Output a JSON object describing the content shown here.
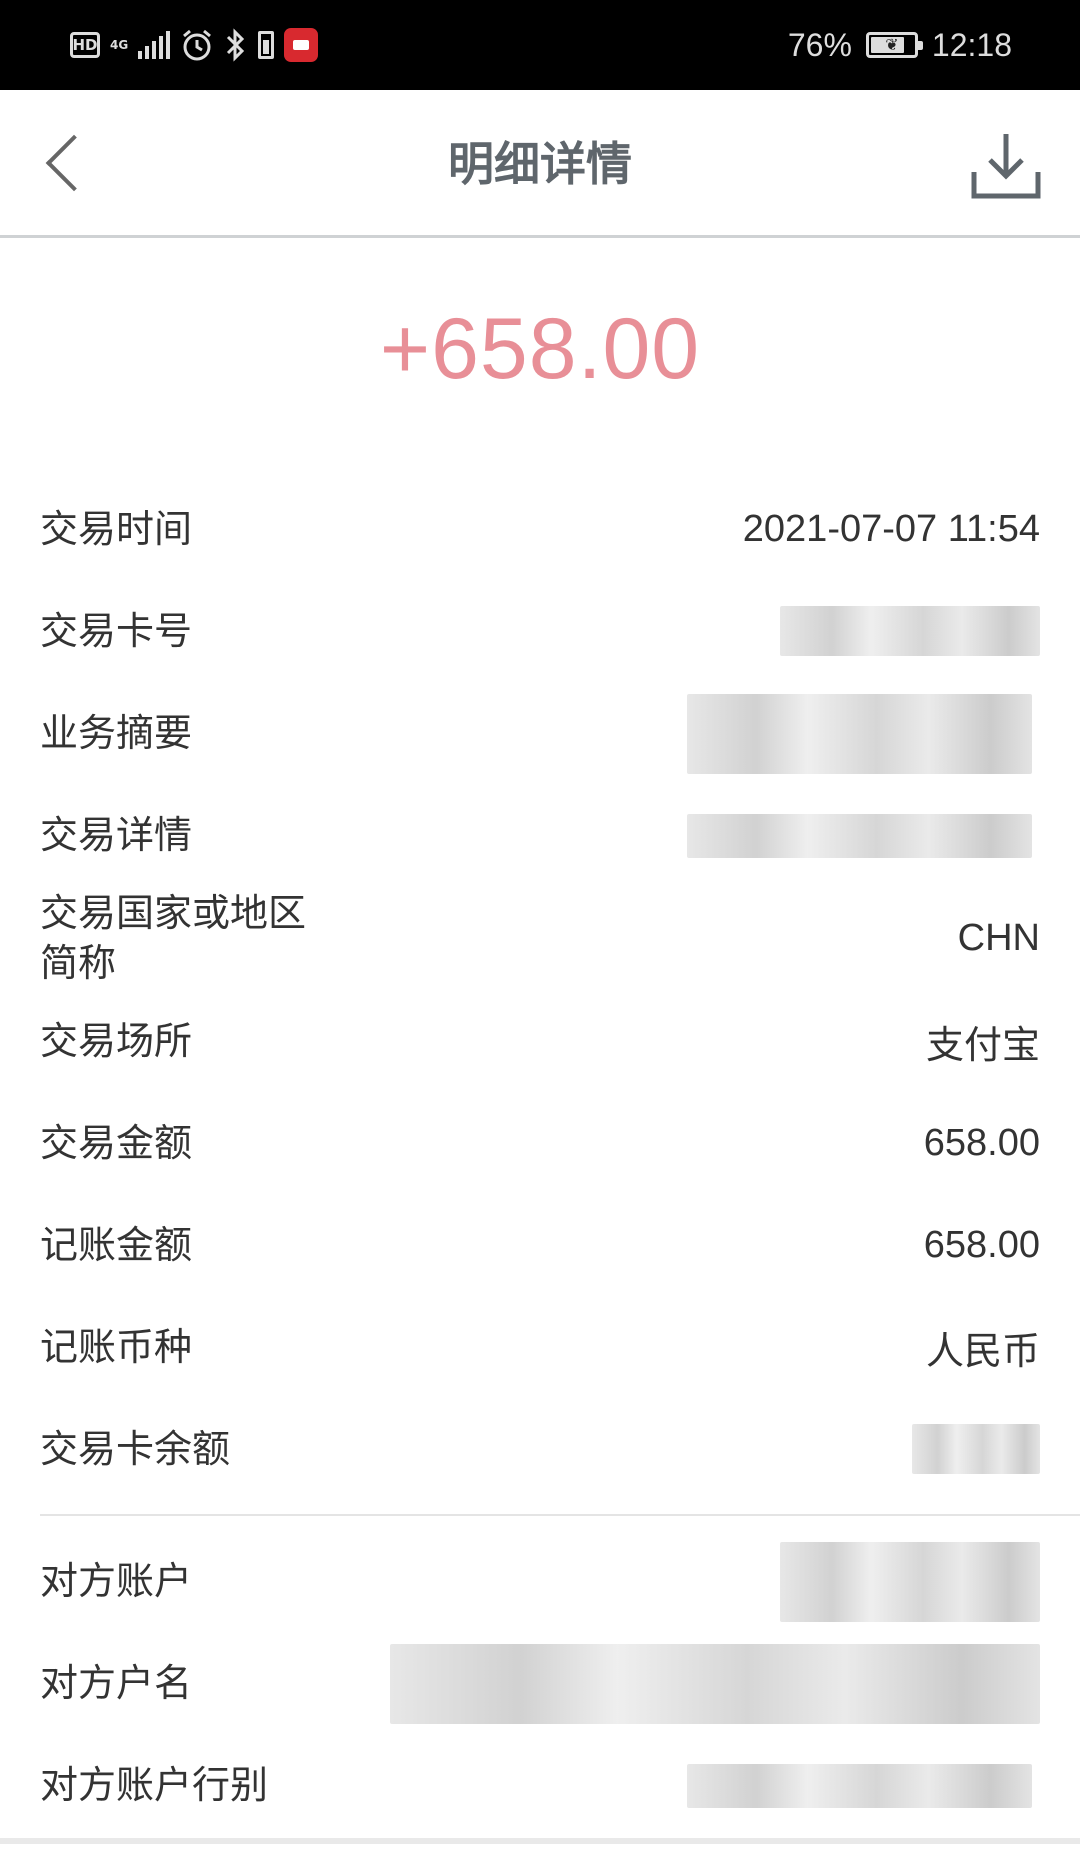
{
  "status_bar": {
    "left_badge": "HD",
    "network_type": "4G",
    "battery_percent": "76%",
    "time": "12:18",
    "icons": [
      "hd-icon",
      "signal-icon",
      "alarm-icon",
      "bluetooth-icon",
      "battery-icon",
      "screen-record-icon"
    ]
  },
  "header": {
    "title": "明细详情",
    "back_icon": "chevron-left-icon",
    "download_icon": "download-icon"
  },
  "amount": "+658.00",
  "colors": {
    "amount": "#e88f97",
    "title": "#5f666c",
    "text": "#333333"
  },
  "details": [
    {
      "label": "交易时间",
      "value": "2021-07-07 11:54"
    },
    {
      "label": "交易卡号",
      "value": ""
    },
    {
      "label": "业务摘要",
      "value": ""
    },
    {
      "label": "交易详情",
      "value": ""
    },
    {
      "label": "交易国家或地区\n简称",
      "value": "CHN"
    },
    {
      "label": "交易场所",
      "value": "支付宝"
    },
    {
      "label": "交易金额",
      "value": "658.00"
    },
    {
      "label": "记账金额",
      "value": "658.00"
    },
    {
      "label": "记账币种",
      "value": "人民币"
    },
    {
      "label": "交易卡余额",
      "value": ""
    }
  ],
  "counterparty": [
    {
      "label": "对方账户",
      "value": ""
    },
    {
      "label": "对方户名",
      "value": ""
    },
    {
      "label": "对方账户行别",
      "value": ""
    }
  ]
}
